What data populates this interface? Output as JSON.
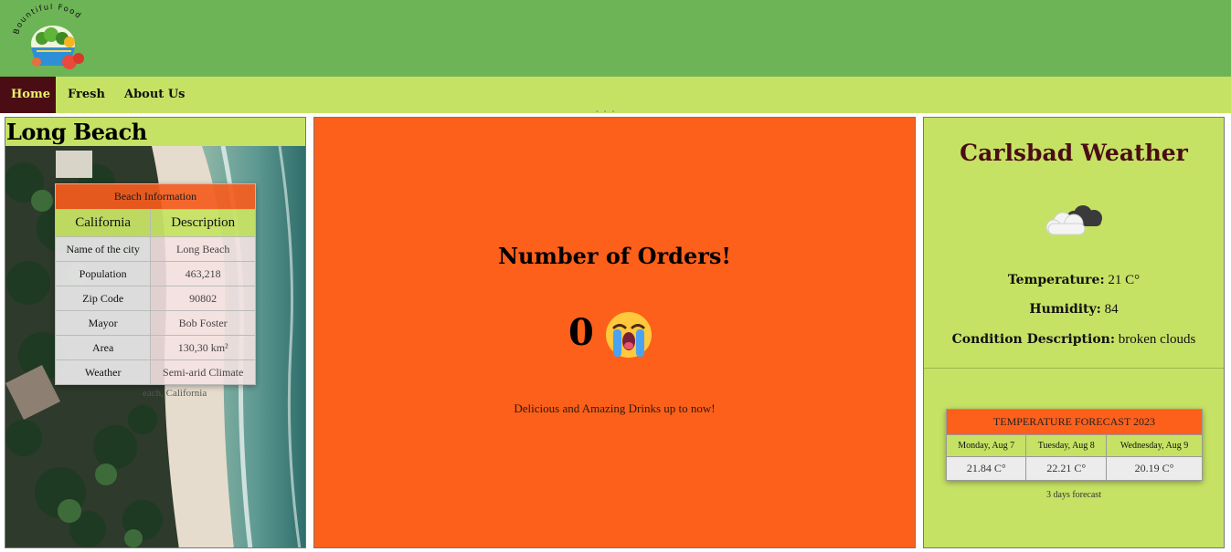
{
  "brand": {
    "logo_text": "Bountiful Food"
  },
  "nav": {
    "items": [
      {
        "label": "Home",
        "active": true
      },
      {
        "label": "Fresh",
        "active": false
      },
      {
        "label": "About Us",
        "active": false
      }
    ]
  },
  "left": {
    "title": "Long Beach",
    "table": {
      "caption": "Beach Information",
      "headers": [
        "California",
        "Description"
      ],
      "rows": [
        {
          "key": "Name of the city",
          "value": "Long Beach"
        },
        {
          "key": "Population",
          "value": "463,218"
        },
        {
          "key": "Zip Code",
          "value": "90802"
        },
        {
          "key": "Mayor",
          "value": "Bob Foster"
        },
        {
          "key": "Area",
          "value": "130,30 km²"
        },
        {
          "key": "Weather",
          "value": "Semi-arid Climate"
        }
      ]
    },
    "photo_caption": "each, California"
  },
  "middle": {
    "title": "Number of Orders!",
    "count": "0",
    "emoji": "loudly-crying-face-icon",
    "subtitle": "Delicious and Amazing Drinks up to now!"
  },
  "right": {
    "title": "Carlsbad Weather",
    "icon": "broken-clouds-icon",
    "temperature_label": "Temperature:",
    "temperature_value": "21 C°",
    "humidity_label": "Humidity:",
    "humidity_value": "84",
    "condition_label": "Condition Description:",
    "condition_value": "broken clouds",
    "forecast": {
      "caption": "TEMPERATURE FORECAST 2023",
      "days": [
        "Monday, Aug 7",
        "Tuesday, Aug 8",
        "Wednesday, Aug 9"
      ],
      "temps": [
        "21.84 C°",
        "22.21 C°",
        "20.19 C°"
      ],
      "note": "3 days forecast"
    }
  },
  "colors": {
    "header_green": "#6db456",
    "nav_lime": "#c6e264",
    "active_maroon": "#4a0d14",
    "orange": "#fd601b"
  }
}
